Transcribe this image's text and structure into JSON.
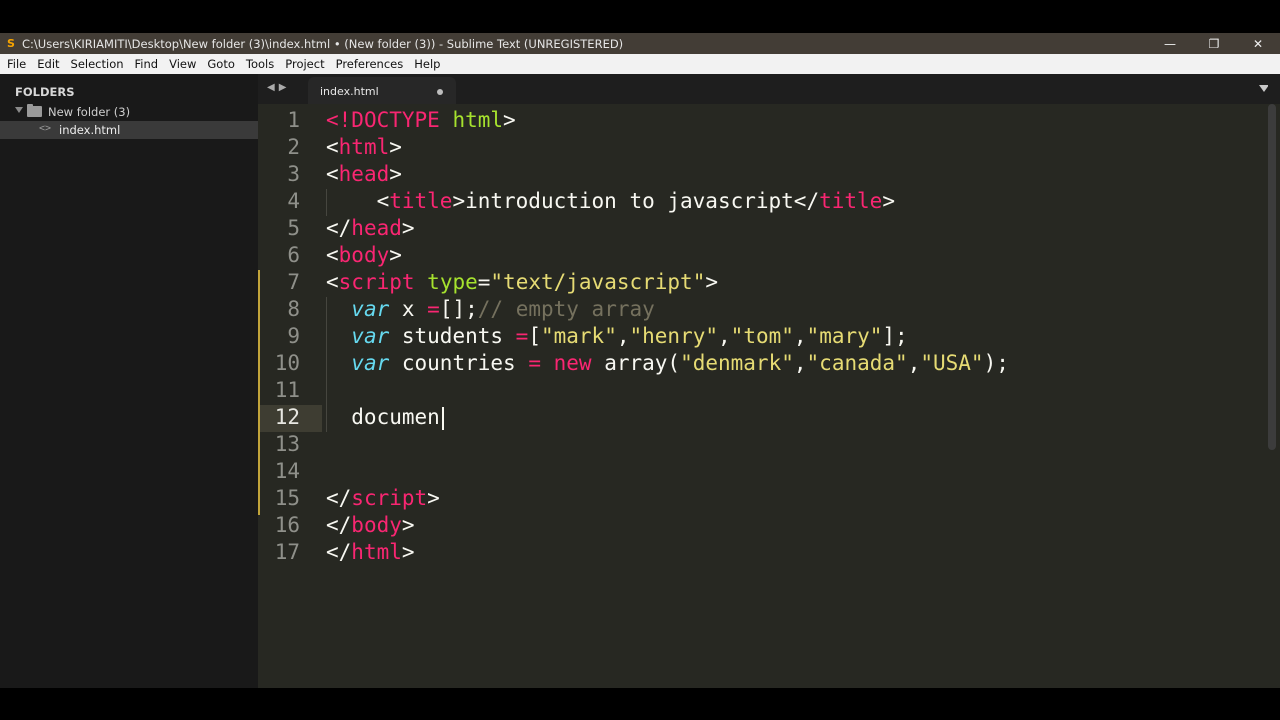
{
  "window": {
    "title": "C:\\Users\\KIRIAMITI\\Desktop\\New folder (3)\\index.html • (New folder (3)) - Sublime Text (UNREGISTERED)",
    "app_icon": "sublime-text-icon",
    "controls": [
      "minimize-icon",
      "restore-icon",
      "close-icon"
    ]
  },
  "menu": [
    "File",
    "Edit",
    "Selection",
    "Find",
    "View",
    "Goto",
    "Tools",
    "Project",
    "Preferences",
    "Help"
  ],
  "sidebar": {
    "header": "FOLDERS",
    "folder": "New folder (3)",
    "file": "index.html"
  },
  "tab": {
    "label": "index.html",
    "dirty": true
  },
  "editor": {
    "current_line": 12,
    "lines": [
      {
        "n": "1",
        "tokens": [
          [
            "t",
            "<!"
          ],
          [
            "t2",
            "DOCTYPE"
          ],
          [
            "p",
            " "
          ],
          [
            "a",
            "html"
          ],
          [
            "p",
            ">"
          ]
        ]
      },
      {
        "n": "2",
        "tokens": [
          [
            "p",
            "<"
          ],
          [
            "t2",
            "html"
          ],
          [
            "p",
            ">"
          ]
        ]
      },
      {
        "n": "3",
        "tokens": [
          [
            "p",
            "<"
          ],
          [
            "t2",
            "head"
          ],
          [
            "p",
            ">"
          ]
        ]
      },
      {
        "n": "4",
        "tokens": [
          [
            "p",
            "    <"
          ],
          [
            "t2",
            "title"
          ],
          [
            "p",
            ">introduction to javascript</"
          ],
          [
            "t2",
            "title"
          ],
          [
            "p",
            ">"
          ]
        ]
      },
      {
        "n": "5",
        "tokens": [
          [
            "p",
            "</"
          ],
          [
            "t2",
            "head"
          ],
          [
            "p",
            ">"
          ]
        ]
      },
      {
        "n": "6",
        "tokens": [
          [
            "p",
            "<"
          ],
          [
            "t2",
            "body"
          ],
          [
            "p",
            ">"
          ]
        ]
      },
      {
        "n": "7",
        "tokens": [
          [
            "p",
            "<"
          ],
          [
            "t2",
            "script"
          ],
          [
            "p",
            " "
          ],
          [
            "a",
            "type"
          ],
          [
            "p",
            "="
          ],
          [
            "s",
            "\"text/javascript\""
          ],
          [
            "p",
            ">"
          ]
        ]
      },
      {
        "n": "8",
        "tokens": [
          [
            "p",
            "  "
          ],
          [
            "k",
            "var"
          ],
          [
            "p",
            " x "
          ],
          [
            "o",
            "="
          ],
          [
            "p",
            "[];"
          ],
          [
            "c",
            "// empty array"
          ]
        ]
      },
      {
        "n": "9",
        "tokens": [
          [
            "p",
            "  "
          ],
          [
            "k",
            "var"
          ],
          [
            "p",
            " students "
          ],
          [
            "o",
            "="
          ],
          [
            "p",
            "["
          ],
          [
            "s",
            "\"mark\""
          ],
          [
            "p",
            ","
          ],
          [
            "s",
            "\"henry\""
          ],
          [
            "p",
            ","
          ],
          [
            "s",
            "\"tom\""
          ],
          [
            "p",
            ","
          ],
          [
            "s",
            "\"mary\""
          ],
          [
            "p",
            "];"
          ]
        ]
      },
      {
        "n": "10",
        "tokens": [
          [
            "p",
            "  "
          ],
          [
            "k",
            "var"
          ],
          [
            "p",
            " countries "
          ],
          [
            "o",
            "="
          ],
          [
            "p",
            " "
          ],
          [
            "o",
            "new"
          ],
          [
            "p",
            " array("
          ],
          [
            "s",
            "\"denmark\""
          ],
          [
            "p",
            ","
          ],
          [
            "s",
            "\"canada\""
          ],
          [
            "p",
            ","
          ],
          [
            "s",
            "\"USA\""
          ],
          [
            "p",
            ");"
          ]
        ]
      },
      {
        "n": "11",
        "tokens": []
      },
      {
        "n": "12",
        "tokens": [
          [
            "p",
            "  documen"
          ]
        ]
      },
      {
        "n": "13",
        "tokens": []
      },
      {
        "n": "14",
        "tokens": []
      },
      {
        "n": "15",
        "tokens": [
          [
            "p",
            "</"
          ],
          [
            "t2",
            "script"
          ],
          [
            "p",
            ">"
          ]
        ]
      },
      {
        "n": "16",
        "tokens": [
          [
            "p",
            "</"
          ],
          [
            "t2",
            "body"
          ],
          [
            "p",
            ">"
          ]
        ]
      },
      {
        "n": "17",
        "tokens": [
          [
            "p",
            "</"
          ],
          [
            "t2",
            "html"
          ],
          [
            "p",
            ">"
          ]
        ]
      }
    ]
  },
  "colors": {
    "editor_bg": "#272822",
    "tag": "#f92672",
    "attribute": "#a6e22e",
    "string": "#e6db74",
    "keyword": "#66d9ef",
    "comment": "#75715e",
    "text": "#f8f8f2"
  }
}
